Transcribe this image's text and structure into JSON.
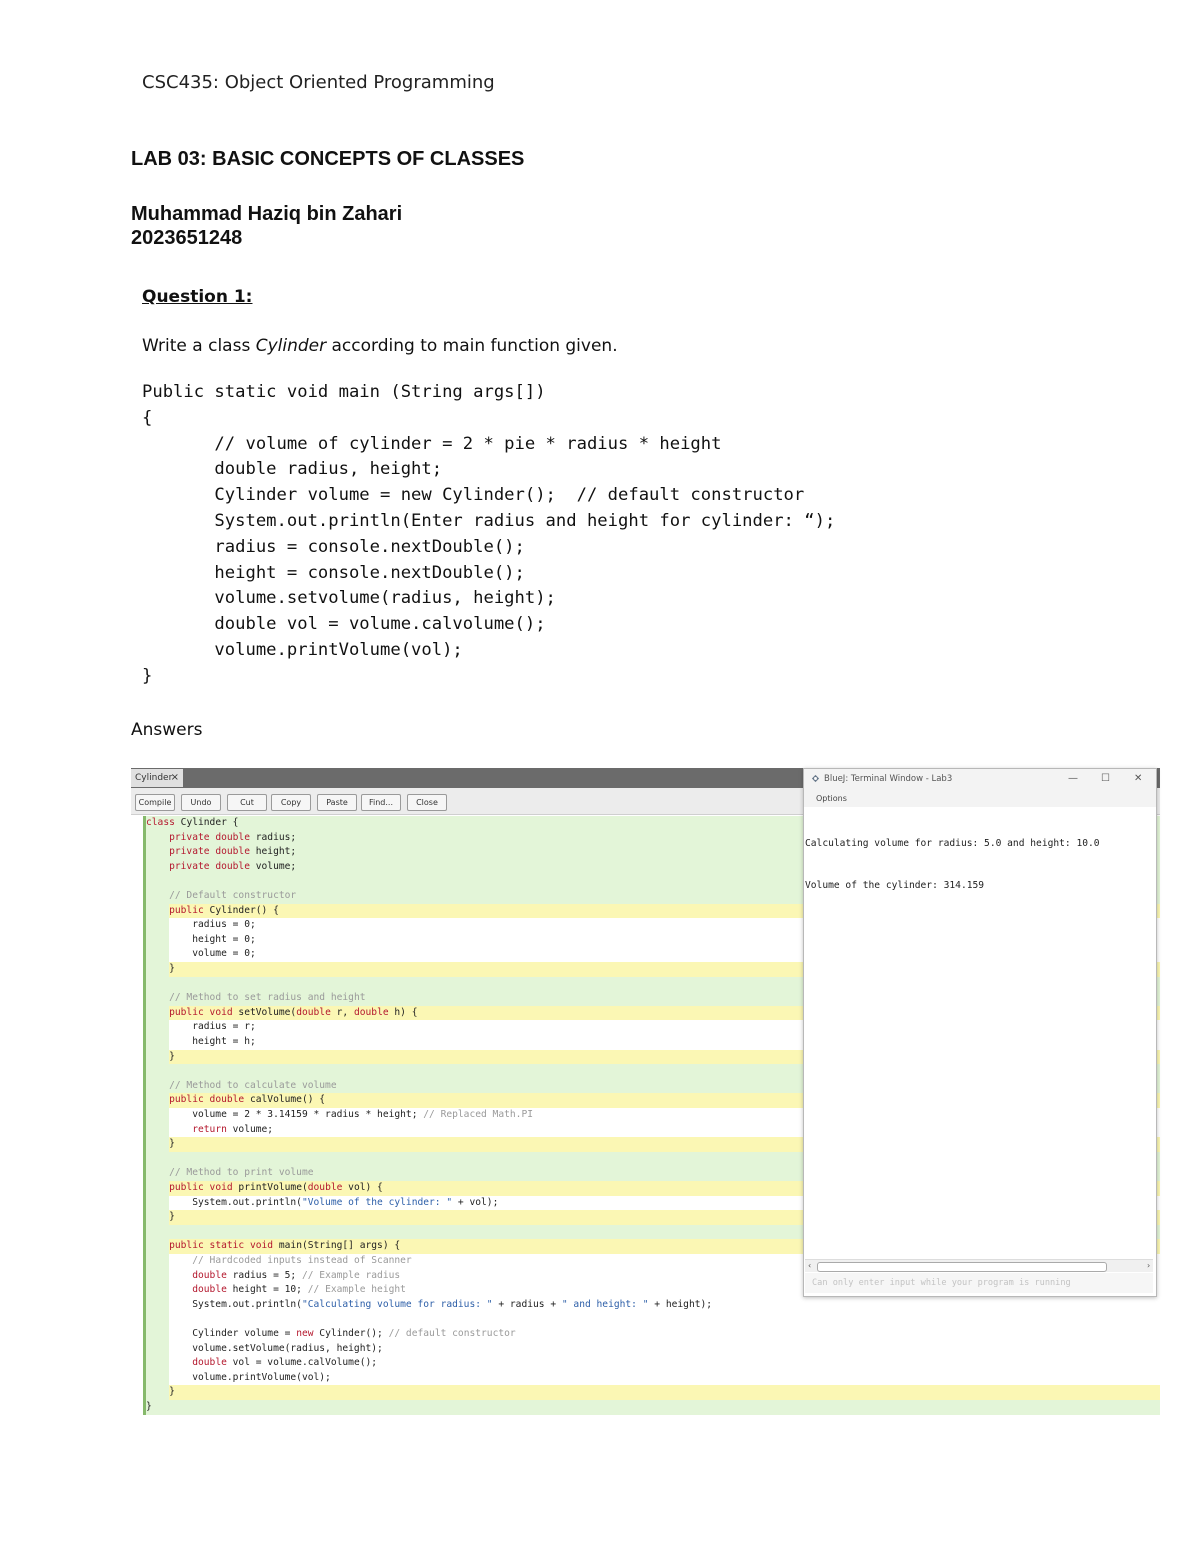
{
  "header": {
    "course": "CSC435: Object Oriented Programming",
    "lab_title": "LAB 03: BASIC CONCEPTS OF CLASSES",
    "student_name": "Muhammad Haziq bin Zahari",
    "student_id": "2023651248"
  },
  "question": {
    "heading": "Question 1:",
    "prefix": "Write a class ",
    "class_name": "Cylinder",
    "suffix": " according to main function given.",
    "code": [
      "Public static void main (String args[])",
      "{",
      "       // volume of cylinder = 2 * pie * radius * height",
      "       double radius, height;",
      "       Cylinder volume = new Cylinder();  // default constructor",
      "       System.out.println(Enter radius and height for cylinder: “);",
      "       radius = console.nextDouble();",
      "       height = console.nextDouble();",
      "       volume.setvolume(radius, height);",
      "       double vol = volume.calvolume();",
      "       volume.printVolume(vol);",
      "}"
    ]
  },
  "answers_label": "Answers",
  "ide": {
    "tab_label": "Cylinder",
    "tab_close": "×",
    "toolbar": [
      "Compile",
      "Undo",
      "Cut",
      "Copy",
      "Paste",
      "Find...",
      "Close"
    ],
    "source_lines": [
      "class Cylinder {",
      "    private double radius;",
      "    private double height;",
      "    private double volume;",
      "",
      "    // Default constructor",
      "    public Cylinder() {",
      "        radius = 0;",
      "        height = 0;",
      "        volume = 0;",
      "    }",
      "",
      "    // Method to set radius and height",
      "    public void setVolume(double r, double h) {",
      "        radius = r;",
      "        height = h;",
      "    }",
      "",
      "    // Method to calculate volume",
      "    public double calVolume() {",
      "        volume = 2 * 3.14159 * radius * height; // Replaced Math.PI",
      "        return volume;",
      "    }",
      "",
      "    // Method to print volume",
      "    public void printVolume(double vol) {",
      "        System.out.println(\"Volume of the cylinder: \" + vol);",
      "    }",
      "",
      "    public static void main(String[] args) {",
      "        // Hardcoded inputs instead of Scanner",
      "        double radius = 5; // Example radius",
      "        double height = 10; // Example height",
      "        System.out.println(\"Calculating volume for radius: \" + radius + \" and height: \" + height);",
      "",
      "        Cylinder volume = new Cylinder(); // default constructor",
      "        volume.setVolume(radius, height);",
      "        double vol = volume.calVolume();",
      "        volume.printVolume(vol);",
      "    }",
      "}"
    ]
  },
  "terminal": {
    "title": "BlueJ: Terminal Window - Lab3",
    "menu": "Options",
    "minimize": "—",
    "maximize": "☐",
    "close": "✕",
    "output": [
      "Calculating volume for radius: 5.0 and height: 10.0",
      "Volume of the cylinder: 314.159"
    ],
    "input_hint": "Can only enter input while your program is running"
  },
  "colors": {
    "keyword": "#b4182e",
    "comment": "#9a9a9a",
    "string": "#2d5fa8",
    "editor_bg": "#e3f5d8",
    "method_band": "#fbf7b4"
  }
}
